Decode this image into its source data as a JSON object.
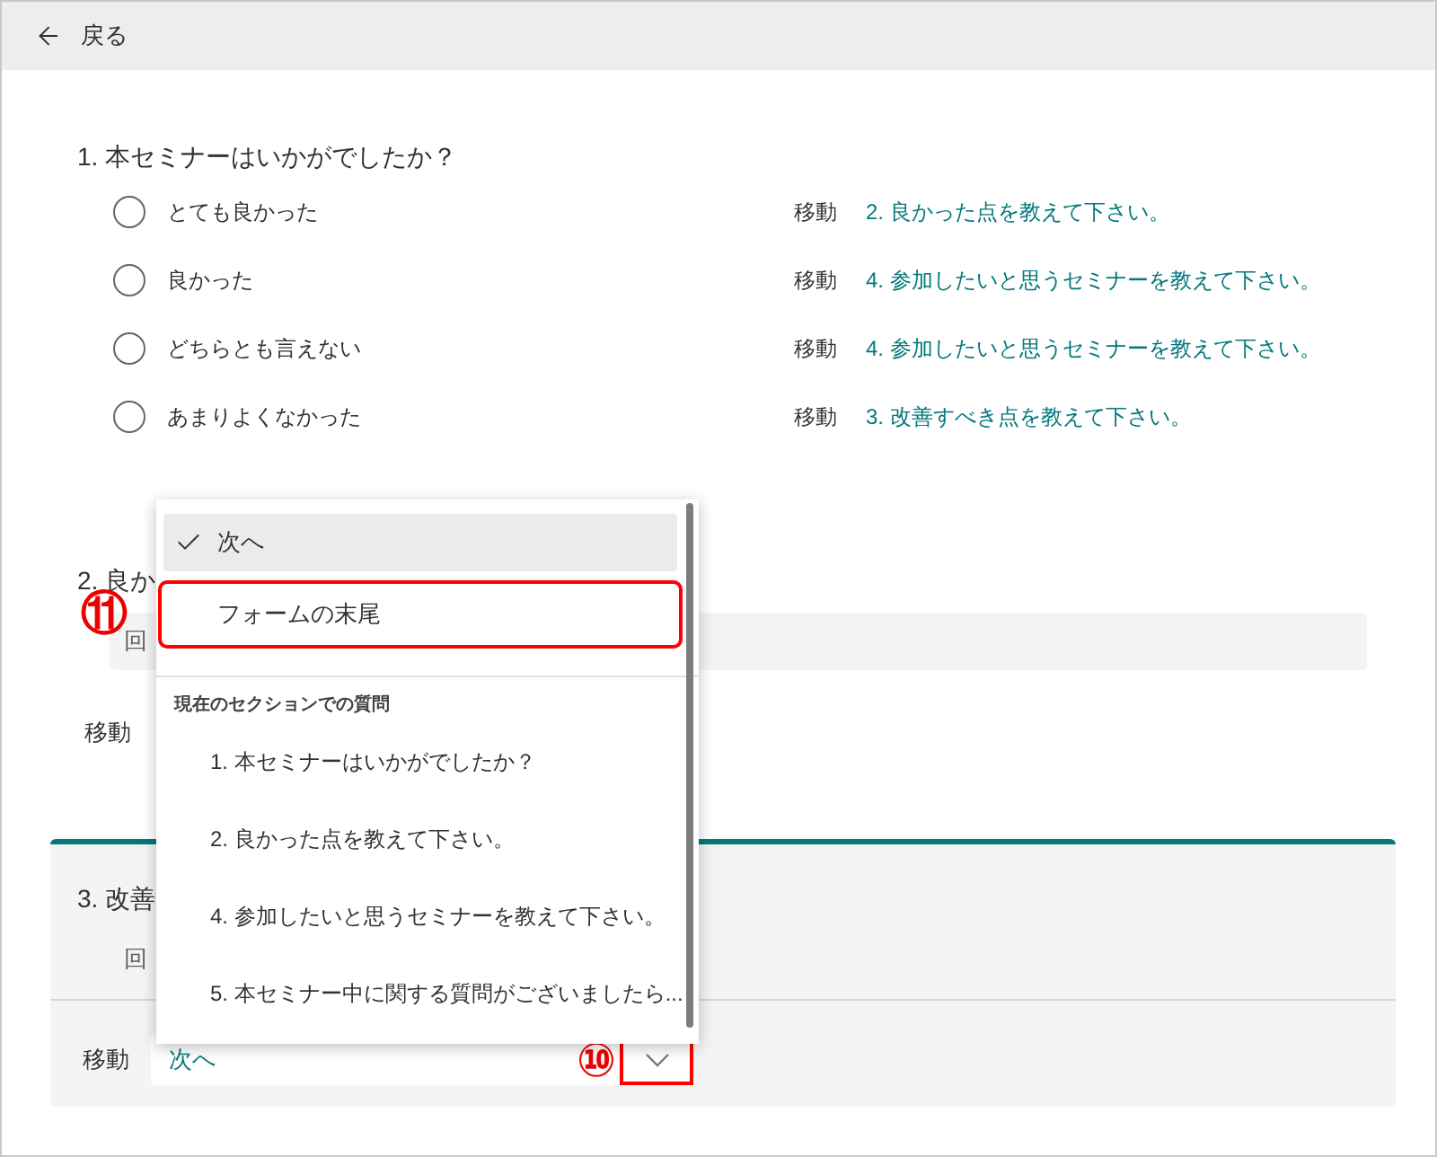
{
  "header": {
    "back_label": "戻る"
  },
  "question1": {
    "title": "1. 本セミナーはいかがでしたか？",
    "options": [
      {
        "label": "とても良かった",
        "selected": false,
        "goto_label": "移動",
        "goto_target": "2. 良かった点を教えて下さい。"
      },
      {
        "label": "良かった",
        "selected": false,
        "goto_label": "移動",
        "goto_target": "4. 参加したいと思うセミナーを教えて下さい。"
      },
      {
        "label": "どちらとも言えない",
        "selected": false,
        "goto_label": "移動",
        "goto_target": "4. 参加したいと思うセミナーを教えて下さい。"
      },
      {
        "label": "あまりよくなかった",
        "selected": false,
        "goto_label": "移動",
        "goto_target": "3. 改善すべき点を教えて下さい。"
      }
    ]
  },
  "question2": {
    "title": "2. 良か",
    "answer_placeholder": "回",
    "goto_label": "移動"
  },
  "question3": {
    "title": "3. 改善",
    "answer_placeholder": "回",
    "goto_label": "移動",
    "goto_value": "次へ",
    "annotated": true,
    "annotation": "⑩"
  },
  "dropdown": {
    "items": [
      {
        "label": "次へ",
        "selected": true,
        "annotated": false
      },
      {
        "label": "フォームの末尾",
        "selected": false,
        "annotated": true,
        "annotation": "⑪"
      }
    ],
    "heading": "現在のセクションでの質問",
    "questions": [
      {
        "label": "1. 本セミナーはいかがでしたか？",
        "selected": false
      },
      {
        "label": "2. 良かった点を教えて下さい。",
        "selected": false
      },
      {
        "label": "4. 参加したいと思うセミナーを教えて下さい。",
        "selected": false
      },
      {
        "label": "5. 本セミナー中に関する質問がございましたら...",
        "selected": false
      }
    ]
  }
}
